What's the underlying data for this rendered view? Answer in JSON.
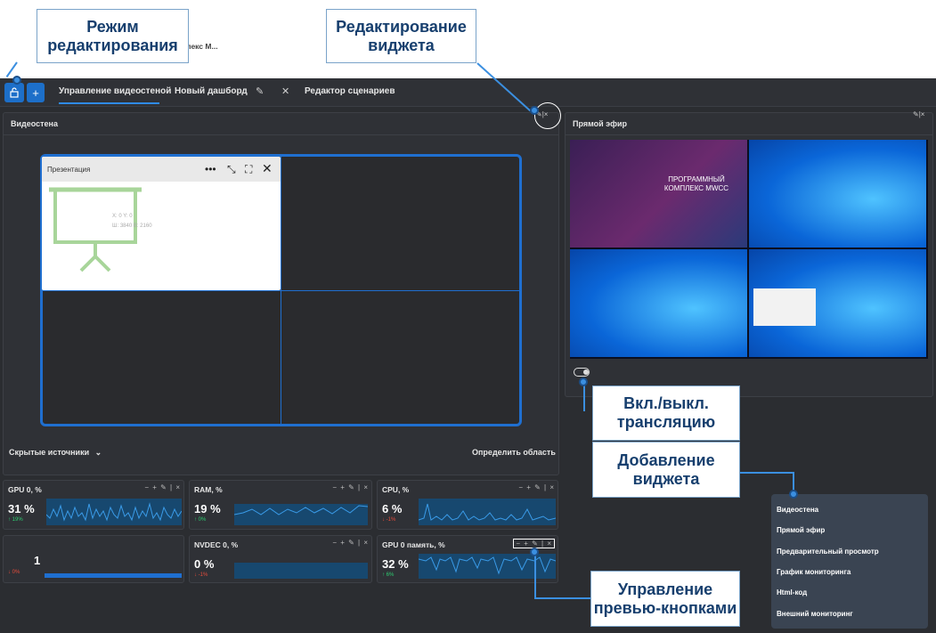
{
  "callouts": {
    "edit_mode": "Режим\nредактирования",
    "widget_edit": "Редактирование\nвиджета",
    "toggle_stream": "Вкл./выкл.\nтрансляцию",
    "add_widget": "Добавление\nвиджета",
    "preview_buttons": "Управление\nпревью-кнопками"
  },
  "tabs": {
    "video_wall": "Управление видеостеной",
    "new_dashboard": "Новый дашборд",
    "scenario_editor": "Редактор сценариев"
  },
  "video_wall_panel": {
    "title": "Видеостена",
    "hidden_sources": "Скрытые источники",
    "define_area": "Определить область",
    "card": {
      "title": "Презентация",
      "name": "Программный комплекс M...",
      "coords": "X: 0 Y: 0",
      "size": "Ш: 3840 В: 2160"
    }
  },
  "live_panel": {
    "title": "Прямой эфир",
    "slide_title": "ПРОГРАММНЫЙ КОМПЛЕКС MWCC"
  },
  "metrics": [
    {
      "title": "GPU 0, %",
      "value": "31 %",
      "delta": "↑ 19%",
      "trend": "up"
    },
    {
      "title": "RAM, %",
      "value": "19 %",
      "delta": "↑ 0%",
      "trend": "up"
    },
    {
      "title": "CPU, %",
      "value": "6 %",
      "delta": "↓ -1%",
      "trend": "down"
    },
    {
      "title": "",
      "value": "1",
      "delta": "↓ 0%",
      "trend": "down"
    },
    {
      "title": "NVDEC 0, %",
      "value": "0 %",
      "delta": "↓ -1%",
      "trend": "down"
    },
    {
      "title": "GPU 0 память, %",
      "value": "32 %",
      "delta": "↑ 6%",
      "trend": "up"
    }
  ],
  "metric_controls": "− + ✎ | ×",
  "widget_menu": [
    "Видеостена",
    "Прямой эфир",
    "Предварительный просмотр",
    "График мониторинга",
    "Html-код",
    "Внешний мониторинг"
  ],
  "colors": {
    "accent": "#1f6fd0",
    "up": "#2ecc71",
    "down": "#e74c3c",
    "callout_text": "#173f6e"
  }
}
